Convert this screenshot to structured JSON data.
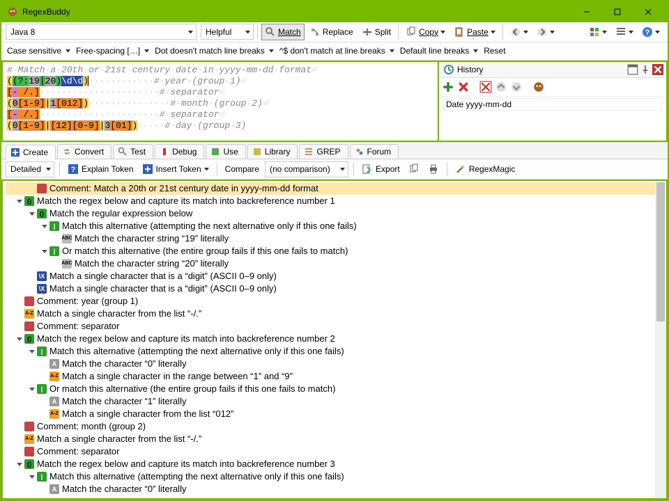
{
  "title": "RegexBuddy",
  "toolbar1": {
    "flavor": "Java 8",
    "mode": "Helpful",
    "match": "Match",
    "replace": "Replace",
    "split": "Split",
    "copy": "Copy",
    "paste": "Paste"
  },
  "toolbar2": {
    "case": "Case sensitive",
    "freespacing": "Free-spacing […]",
    "dot": "Dot doesn't match line breaks",
    "anchors": "^$ don't match at line breaks",
    "linebreaks": "Default line breaks",
    "reset": "Reset"
  },
  "regex_title_comment": "# Match a 20th or 21st century date in yyyy-mm-dd format",
  "regex_lines": [
    "((?:19|20)\\d\\d)",
    "[- /.]",
    "(0[1-9]|1[012])",
    "[- /.]",
    "(0[1-9]|[12][0-9]|3[01])"
  ],
  "regex_comments": [
    "# year (group 1)",
    "# separator",
    "# month (group 2)",
    "# separator",
    "# day (group 3)"
  ],
  "history": {
    "title": "History",
    "item": "Date yyyy-mm-dd"
  },
  "tabs": {
    "create": "Create",
    "convert": "Convert",
    "test": "Test",
    "debug": "Debug",
    "use": "Use",
    "library": "Library",
    "grep": "GREP",
    "forum": "Forum"
  },
  "toolbar3": {
    "detailed": "Detailed",
    "explain": "Explain Token",
    "insert": "Insert Token",
    "compare": "Compare",
    "nocmp": "(no comparison)",
    "export": "Export",
    "regexmagic": "RegexMagic"
  },
  "tree": [
    {
      "d": 1,
      "t": "sel",
      "b": "comment",
      "txt": "Comment: Match a 20th or 21st century date in yyyy-mm-dd format"
    },
    {
      "d": 0,
      "t": "exp",
      "b": "group",
      "txt": "Match the regex below and capture its match into backreference number 1"
    },
    {
      "d": 1,
      "t": "exp",
      "b": "group",
      "txt": "Match the regular expression below"
    },
    {
      "d": 2,
      "t": "exp",
      "b": "alt",
      "txt": "Match this alternative (attempting the next alternative only if this one fails)"
    },
    {
      "d": 3,
      "t": "",
      "b": "abc",
      "txt": "Match the character string “19” literally"
    },
    {
      "d": 2,
      "t": "exp",
      "b": "alt",
      "txt": "Or match this alternative (the entire group fails if this one fails to match)"
    },
    {
      "d": 3,
      "t": "",
      "b": "abc",
      "txt": "Match the character string “20” literally"
    },
    {
      "d": 1,
      "t": "",
      "b": "digit",
      "txt": "Match a single character that is a “digit” (ASCII 0–9 only)"
    },
    {
      "d": 1,
      "t": "",
      "b": "digit",
      "txt": "Match a single character that is a “digit” (ASCII 0–9 only)"
    },
    {
      "d": 0,
      "t": "",
      "b": "comment",
      "txt": "Comment: year (group 1)"
    },
    {
      "d": 0,
      "t": "",
      "b": "az",
      "txt": "Match a single character from the list “-/.”"
    },
    {
      "d": 0,
      "t": "",
      "b": "comment",
      "txt": "Comment: separator"
    },
    {
      "d": 0,
      "t": "exp",
      "b": "group",
      "txt": "Match the regex below and capture its match into backreference number 2"
    },
    {
      "d": 1,
      "t": "exp",
      "b": "alt",
      "txt": "Match this alternative (attempting the next alternative only if this one fails)"
    },
    {
      "d": 2,
      "t": "",
      "b": "char",
      "txt": "Match the character “0” literally"
    },
    {
      "d": 2,
      "t": "",
      "b": "az",
      "txt": "Match a single character in the range between “1” and “9”"
    },
    {
      "d": 1,
      "t": "exp",
      "b": "alt",
      "txt": "Or match this alternative (the entire group fails if this one fails to match)"
    },
    {
      "d": 2,
      "t": "",
      "b": "char",
      "txt": "Match the character “1” literally"
    },
    {
      "d": 2,
      "t": "",
      "b": "az",
      "txt": "Match a single character from the list “012”"
    },
    {
      "d": 0,
      "t": "",
      "b": "comment",
      "txt": "Comment: month (group 2)"
    },
    {
      "d": 0,
      "t": "",
      "b": "az",
      "txt": "Match a single character from the list “-/.”"
    },
    {
      "d": 0,
      "t": "",
      "b": "comment",
      "txt": "Comment: separator"
    },
    {
      "d": 0,
      "t": "exp",
      "b": "group",
      "txt": "Match the regex below and capture its match into backreference number 3"
    },
    {
      "d": 1,
      "t": "exp",
      "b": "alt",
      "txt": "Match this alternative (attempting the next alternative only if this one fails)"
    },
    {
      "d": 2,
      "t": "",
      "b": "char",
      "txt": "Match the character “0” literally"
    }
  ]
}
